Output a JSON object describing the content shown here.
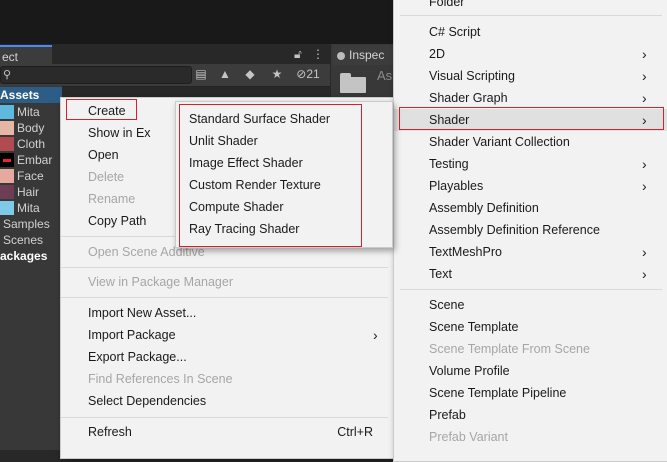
{
  "colors": {
    "menu_bg": "#f2f2f2",
    "menu_text": "#1a1a1a",
    "menu_disabled": "#a6a6a6",
    "highlight_box": "#d5222a",
    "editor_bg": "#383838",
    "selection": "#2c5d87"
  },
  "project_panel": {
    "tab_label": "ect",
    "search_icon": "search-icon",
    "toolbar": {
      "hidden_count": "21"
    },
    "tree": [
      {
        "label": "Assets",
        "kind": "header"
      },
      {
        "label": "Mita",
        "kind": "prefab"
      },
      {
        "label": "Body",
        "kind": "texture"
      },
      {
        "label": "Cloth",
        "kind": "texture"
      },
      {
        "label": "Embar",
        "kind": "texture"
      },
      {
        "label": "Face",
        "kind": "texture"
      },
      {
        "label": "Hair",
        "kind": "texture"
      },
      {
        "label": "Mita",
        "kind": "prefab"
      },
      {
        "label": "Samples",
        "kind": "folder"
      },
      {
        "label": "Scenes",
        "kind": "folder"
      },
      {
        "label": "ackages",
        "kind": "header"
      }
    ]
  },
  "inspector": {
    "tab_label": "Inspec",
    "folder_label": "As"
  },
  "context_menu": {
    "items": [
      {
        "label": "Create"
      },
      {
        "label": "Show in Ex"
      },
      {
        "label": "Open"
      },
      {
        "label": "Delete"
      },
      {
        "label": "Rename"
      },
      {
        "label": "Copy Path"
      },
      {
        "label": "Open Scene Additive"
      },
      {
        "label": "View in Package Manager"
      },
      {
        "label": "Import New Asset..."
      },
      {
        "label": "Import Package"
      },
      {
        "label": "Export Package..."
      },
      {
        "label": "Find References In Scene"
      },
      {
        "label": "Select Dependencies"
      },
      {
        "label": "Refresh",
        "shortcut": "Ctrl+R"
      }
    ]
  },
  "shader_submenu": {
    "items": [
      {
        "label": "Standard Surface Shader"
      },
      {
        "label": "Unlit Shader"
      },
      {
        "label": "Image Effect Shader"
      },
      {
        "label": "Custom Render Texture"
      },
      {
        "label": "Compute Shader"
      },
      {
        "label": "Ray Tracing Shader"
      }
    ]
  },
  "create_submenu": {
    "items": [
      {
        "label": "Folder"
      },
      {
        "label": "C# Script"
      },
      {
        "label": "2D"
      },
      {
        "label": "Visual Scripting"
      },
      {
        "label": "Shader Graph"
      },
      {
        "label": "Shader"
      },
      {
        "label": "Shader Variant Collection"
      },
      {
        "label": "Testing"
      },
      {
        "label": "Playables"
      },
      {
        "label": "Assembly Definition"
      },
      {
        "label": "Assembly Definition Reference"
      },
      {
        "label": "TextMeshPro"
      },
      {
        "label": "Text"
      },
      {
        "label": "Scene"
      },
      {
        "label": "Scene Template"
      },
      {
        "label": "Scene Template From Scene"
      },
      {
        "label": "Volume Profile"
      },
      {
        "label": "Scene Template Pipeline"
      },
      {
        "label": "Prefab"
      },
      {
        "label": "Prefab Variant"
      }
    ]
  }
}
